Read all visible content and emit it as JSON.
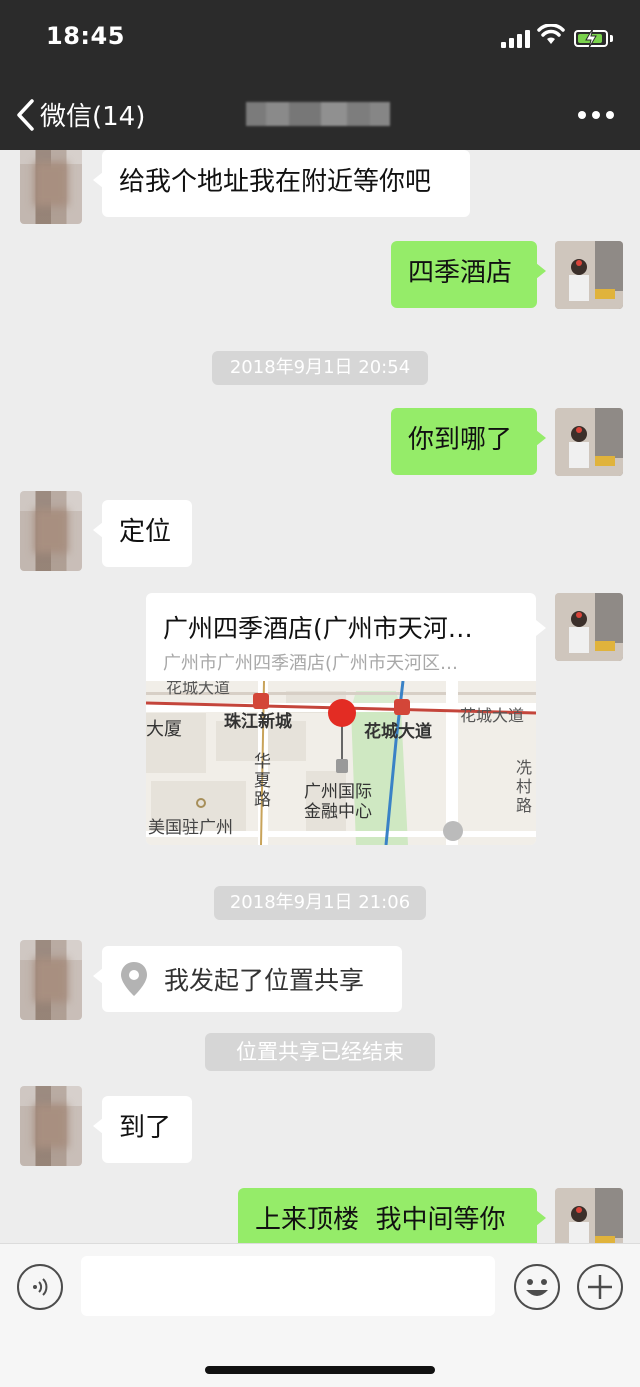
{
  "status_bar": {
    "time": "18:45"
  },
  "nav": {
    "back_label": "微信(14)"
  },
  "messages": {
    "m1": "给我个地址我在附近等你吧",
    "m2": "四季酒店",
    "ts1": "2018年9月1日 20:54",
    "m3": "你到哪了",
    "m4": "定位",
    "location": {
      "title": "广州四季酒店(广州市天河…",
      "subtitle": "广州市广州四季酒店(广州市天河区…",
      "map_labels": {
        "road1": "花城大道",
        "road2": "花城大道",
        "road3": "花城大道",
        "area1": "珠江新城",
        "area2": "大厦",
        "road4": "华夏路",
        "ifc": "广州国际金融中心",
        "road5": "冼村路",
        "consulate": "美国驻广州"
      }
    },
    "ts2": "2018年9月1日 21:06",
    "share": "我发起了位置共享",
    "sys": "位置共享已经结束",
    "m5": "到了",
    "m6": "上来顶楼  我中间等你"
  },
  "input": {
    "placeholder": ""
  },
  "colors": {
    "accent_green": "#95ec69",
    "nav_bg": "#2b2b2b"
  },
  "icons": [
    "chevron-left-icon",
    "more-icon",
    "location-pin-icon",
    "voice-icon",
    "emoji-icon",
    "plus-icon"
  ]
}
